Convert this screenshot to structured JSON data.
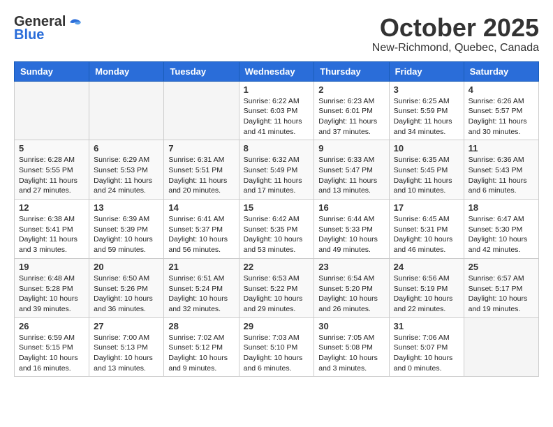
{
  "header": {
    "logo_general": "General",
    "logo_blue": "Blue",
    "title": "October 2025",
    "subtitle": "New-Richmond, Quebec, Canada"
  },
  "days_of_week": [
    "Sunday",
    "Monday",
    "Tuesday",
    "Wednesday",
    "Thursday",
    "Friday",
    "Saturday"
  ],
  "weeks": [
    [
      {
        "day": "",
        "info": ""
      },
      {
        "day": "",
        "info": ""
      },
      {
        "day": "",
        "info": ""
      },
      {
        "day": "1",
        "info": "Sunrise: 6:22 AM\nSunset: 6:03 PM\nDaylight: 11 hours\nand 41 minutes."
      },
      {
        "day": "2",
        "info": "Sunrise: 6:23 AM\nSunset: 6:01 PM\nDaylight: 11 hours\nand 37 minutes."
      },
      {
        "day": "3",
        "info": "Sunrise: 6:25 AM\nSunset: 5:59 PM\nDaylight: 11 hours\nand 34 minutes."
      },
      {
        "day": "4",
        "info": "Sunrise: 6:26 AM\nSunset: 5:57 PM\nDaylight: 11 hours\nand 30 minutes."
      }
    ],
    [
      {
        "day": "5",
        "info": "Sunrise: 6:28 AM\nSunset: 5:55 PM\nDaylight: 11 hours\nand 27 minutes."
      },
      {
        "day": "6",
        "info": "Sunrise: 6:29 AM\nSunset: 5:53 PM\nDaylight: 11 hours\nand 24 minutes."
      },
      {
        "day": "7",
        "info": "Sunrise: 6:31 AM\nSunset: 5:51 PM\nDaylight: 11 hours\nand 20 minutes."
      },
      {
        "day": "8",
        "info": "Sunrise: 6:32 AM\nSunset: 5:49 PM\nDaylight: 11 hours\nand 17 minutes."
      },
      {
        "day": "9",
        "info": "Sunrise: 6:33 AM\nSunset: 5:47 PM\nDaylight: 11 hours\nand 13 minutes."
      },
      {
        "day": "10",
        "info": "Sunrise: 6:35 AM\nSunset: 5:45 PM\nDaylight: 11 hours\nand 10 minutes."
      },
      {
        "day": "11",
        "info": "Sunrise: 6:36 AM\nSunset: 5:43 PM\nDaylight: 11 hours\nand 6 minutes."
      }
    ],
    [
      {
        "day": "12",
        "info": "Sunrise: 6:38 AM\nSunset: 5:41 PM\nDaylight: 11 hours\nand 3 minutes."
      },
      {
        "day": "13",
        "info": "Sunrise: 6:39 AM\nSunset: 5:39 PM\nDaylight: 10 hours\nand 59 minutes."
      },
      {
        "day": "14",
        "info": "Sunrise: 6:41 AM\nSunset: 5:37 PM\nDaylight: 10 hours\nand 56 minutes."
      },
      {
        "day": "15",
        "info": "Sunrise: 6:42 AM\nSunset: 5:35 PM\nDaylight: 10 hours\nand 53 minutes."
      },
      {
        "day": "16",
        "info": "Sunrise: 6:44 AM\nSunset: 5:33 PM\nDaylight: 10 hours\nand 49 minutes."
      },
      {
        "day": "17",
        "info": "Sunrise: 6:45 AM\nSunset: 5:31 PM\nDaylight: 10 hours\nand 46 minutes."
      },
      {
        "day": "18",
        "info": "Sunrise: 6:47 AM\nSunset: 5:30 PM\nDaylight: 10 hours\nand 42 minutes."
      }
    ],
    [
      {
        "day": "19",
        "info": "Sunrise: 6:48 AM\nSunset: 5:28 PM\nDaylight: 10 hours\nand 39 minutes."
      },
      {
        "day": "20",
        "info": "Sunrise: 6:50 AM\nSunset: 5:26 PM\nDaylight: 10 hours\nand 36 minutes."
      },
      {
        "day": "21",
        "info": "Sunrise: 6:51 AM\nSunset: 5:24 PM\nDaylight: 10 hours\nand 32 minutes."
      },
      {
        "day": "22",
        "info": "Sunrise: 6:53 AM\nSunset: 5:22 PM\nDaylight: 10 hours\nand 29 minutes."
      },
      {
        "day": "23",
        "info": "Sunrise: 6:54 AM\nSunset: 5:20 PM\nDaylight: 10 hours\nand 26 minutes."
      },
      {
        "day": "24",
        "info": "Sunrise: 6:56 AM\nSunset: 5:19 PM\nDaylight: 10 hours\nand 22 minutes."
      },
      {
        "day": "25",
        "info": "Sunrise: 6:57 AM\nSunset: 5:17 PM\nDaylight: 10 hours\nand 19 minutes."
      }
    ],
    [
      {
        "day": "26",
        "info": "Sunrise: 6:59 AM\nSunset: 5:15 PM\nDaylight: 10 hours\nand 16 minutes."
      },
      {
        "day": "27",
        "info": "Sunrise: 7:00 AM\nSunset: 5:13 PM\nDaylight: 10 hours\nand 13 minutes."
      },
      {
        "day": "28",
        "info": "Sunrise: 7:02 AM\nSunset: 5:12 PM\nDaylight: 10 hours\nand 9 minutes."
      },
      {
        "day": "29",
        "info": "Sunrise: 7:03 AM\nSunset: 5:10 PM\nDaylight: 10 hours\nand 6 minutes."
      },
      {
        "day": "30",
        "info": "Sunrise: 7:05 AM\nSunset: 5:08 PM\nDaylight: 10 hours\nand 3 minutes."
      },
      {
        "day": "31",
        "info": "Sunrise: 7:06 AM\nSunset: 5:07 PM\nDaylight: 10 hours\nand 0 minutes."
      },
      {
        "day": "",
        "info": ""
      }
    ]
  ]
}
